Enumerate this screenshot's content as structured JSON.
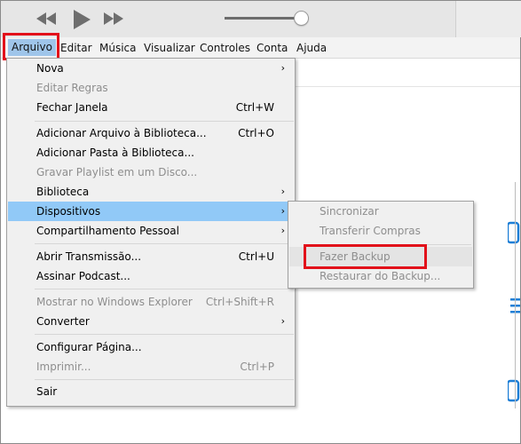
{
  "menubar": {
    "items": [
      "Arquivo",
      "Editar",
      "Música",
      "Visualizar",
      "Controles",
      "Conta",
      "Ajuda"
    ]
  },
  "player": {
    "rewind_icon": "rewind-icon",
    "play_icon": "play-icon",
    "forward_icon": "fast-forward-icon",
    "volume_level": 0.9
  },
  "file_menu": {
    "items": [
      {
        "label": "Nova",
        "shortcut": "",
        "submenu": true,
        "disabled": false
      },
      {
        "label": "Editar Regras",
        "shortcut": "",
        "submenu": false,
        "disabled": true
      },
      {
        "label": "Fechar Janela",
        "shortcut": "Ctrl+W",
        "submenu": false,
        "disabled": false
      },
      {
        "label": "Adicionar Arquivo à Biblioteca...",
        "shortcut": "Ctrl+O",
        "submenu": false,
        "disabled": false
      },
      {
        "label": "Adicionar Pasta à Biblioteca...",
        "shortcut": "",
        "submenu": false,
        "disabled": false
      },
      {
        "label": "Gravar Playlist em um Disco...",
        "shortcut": "",
        "submenu": false,
        "disabled": true
      },
      {
        "label": "Biblioteca",
        "shortcut": "",
        "submenu": true,
        "disabled": false
      },
      {
        "label": "Dispositivos",
        "shortcut": "",
        "submenu": true,
        "disabled": false,
        "selected": true
      },
      {
        "label": "Compartilhamento Pessoal",
        "shortcut": "",
        "submenu": true,
        "disabled": false
      },
      {
        "label": "Abrir Transmissão...",
        "shortcut": "Ctrl+U",
        "submenu": false,
        "disabled": false
      },
      {
        "label": "Assinar Podcast...",
        "shortcut": "",
        "submenu": false,
        "disabled": false
      },
      {
        "label": "Mostrar no Windows Explorer",
        "shortcut": "Ctrl+Shift+R",
        "submenu": false,
        "disabled": true
      },
      {
        "label": "Converter",
        "shortcut": "",
        "submenu": true,
        "disabled": false
      },
      {
        "label": "Configurar Página...",
        "shortcut": "",
        "submenu": false,
        "disabled": false
      },
      {
        "label": "Imprimir...",
        "shortcut": "Ctrl+P",
        "submenu": false,
        "disabled": true
      },
      {
        "label": "Sair",
        "shortcut": "",
        "submenu": false,
        "disabled": false
      }
    ],
    "arrow": "›"
  },
  "devices_submenu": {
    "items": [
      {
        "label": "Sincronizar",
        "disabled": true
      },
      {
        "label": "Transferir Compras",
        "disabled": true
      },
      {
        "label": "Fazer Backup",
        "disabled": true,
        "hover": true
      },
      {
        "label": "Restaurar do Backup...",
        "disabled": true
      }
    ]
  },
  "colors": {
    "highlight_box": "#e2101a",
    "selected_item": "#91c9f7",
    "menubar_active": "#9fc5ea",
    "side_icons": "#1e7fd6"
  }
}
